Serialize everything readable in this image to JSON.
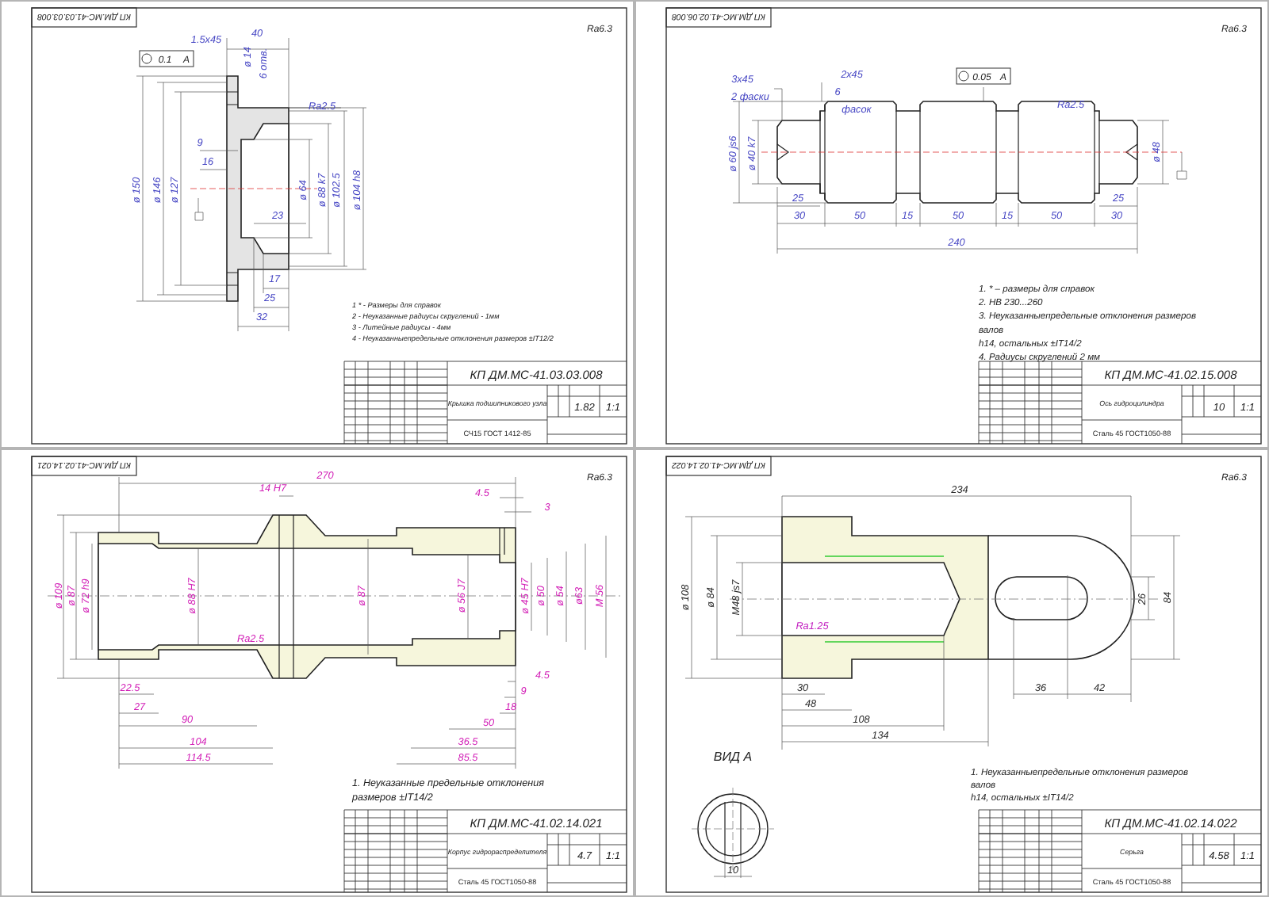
{
  "sheets": [
    {
      "kind": "flange",
      "stamp": "КП ДМ.МС-41.03.03.008",
      "roughness": "Ra6.3",
      "geometric_tolerance": {
        "value": "0.1",
        "datum": "A"
      },
      "annotations": [
        {
          "kind": "dimension",
          "text": "1.5x45"
        },
        {
          "kind": "dimension",
          "text": "40"
        },
        {
          "kind": "dimension",
          "text": "ø 14"
        },
        {
          "kind": "dimension",
          "text": "6 отв."
        },
        {
          "kind": "roughness",
          "text": "Ra2.5"
        },
        {
          "kind": "dimension",
          "text": "ø 150"
        },
        {
          "kind": "dimension",
          "text": "ø 146"
        },
        {
          "kind": "dimension",
          "text": "ø 127"
        },
        {
          "kind": "dimension",
          "text": "9"
        },
        {
          "kind": "dimension",
          "text": "16"
        },
        {
          "kind": "dimension",
          "text": "23"
        },
        {
          "kind": "dimension",
          "text": "ø 64"
        },
        {
          "kind": "dimension",
          "text": "ø 88 k7"
        },
        {
          "kind": "dimension",
          "text": "ø 102.5"
        },
        {
          "kind": "dimension",
          "text": "ø 104 h8"
        },
        {
          "kind": "dimension",
          "text": "17"
        },
        {
          "kind": "dimension",
          "text": "25"
        },
        {
          "kind": "dimension",
          "text": "32"
        }
      ],
      "notes": [
        "1 * - Размеры для справок",
        "2 - Неуказанные радиусы скруглений - 1мм",
        "3 - Литейные радиусы - 4мм",
        "4 - Неуказанныепредельные отклонения размеров ±IT12/2"
      ],
      "title_block": {
        "designation": "КП ДМ.МС-41.03.03.008",
        "name": "Крышка подшипникового узла",
        "material": "СЧ15 ГОСТ 1412-85",
        "mass": "1.82",
        "scale": "1:1"
      }
    },
    {
      "kind": "shaft",
      "stamp": "КП ДМ.МС-41.02.06.008",
      "roughness": "Ra6.3",
      "geometric_tolerance": {
        "value": "0.05",
        "datum": "A"
      },
      "annotations": [
        {
          "kind": "dimension",
          "text": "3x45"
        },
        {
          "kind": "dimension",
          "text": "2 фаски"
        },
        {
          "kind": "dimension",
          "text": "2x45"
        },
        {
          "kind": "dimension",
          "text": "6"
        },
        {
          "kind": "dimension",
          "text": "фасок"
        },
        {
          "kind": "roughness",
          "text": "Ra2.5"
        },
        {
          "kind": "dimension",
          "text": "ø 60 js6"
        },
        {
          "kind": "dimension",
          "text": "ø 40 k7"
        },
        {
          "kind": "dimension",
          "text": "ø 48"
        },
        {
          "kind": "dimension",
          "text": "25"
        },
        {
          "kind": "dimension",
          "text": "30"
        },
        {
          "kind": "dimension",
          "text": "50"
        },
        {
          "kind": "dimension",
          "text": "15"
        },
        {
          "kind": "dimension",
          "text": "50"
        },
        {
          "kind": "dimension",
          "text": "15"
        },
        {
          "kind": "dimension",
          "text": "50"
        },
        {
          "kind": "dimension",
          "text": "30"
        },
        {
          "kind": "dimension",
          "text": "25"
        },
        {
          "kind": "dimension",
          "text": "240"
        }
      ],
      "notes": [
        "1. * – размеры для справок",
        "2. НВ 230...260",
        "3. Неуказанныепредельные отклонения размеров",
        "валов",
        "h14, остальных ±IT14/2",
        "4. Радиусы скруглений 2 мм"
      ],
      "title_block": {
        "designation": "КП ДМ.МС-41.02.15.008",
        "name": "Ось гидроцилиндра",
        "material": "Сталь 45 ГОСТ1050-88",
        "mass": "10",
        "scale": "1:1"
      }
    },
    {
      "kind": "housing",
      "stamp": "КП ДМ.МС-41.02.14.021",
      "roughness": "Ra6.3",
      "annotations": [
        {
          "kind": "dimension",
          "text": "270"
        },
        {
          "kind": "dimension",
          "text": "14 H7"
        },
        {
          "kind": "dimension",
          "text": "4.5"
        },
        {
          "kind": "dimension",
          "text": "3"
        },
        {
          "kind": "dimension",
          "text": "ø 109"
        },
        {
          "kind": "dimension",
          "text": "ø 87"
        },
        {
          "kind": "dimension",
          "text": "ø 72 h9"
        },
        {
          "kind": "dimension",
          "text": "ø 88 H7"
        },
        {
          "kind": "dimension",
          "text": "ø 87"
        },
        {
          "kind": "dimension",
          "text": "ø 56 J7"
        },
        {
          "kind": "dimension",
          "text": "ø 45 H7"
        },
        {
          "kind": "dimension",
          "text": "ø 50"
        },
        {
          "kind": "dimension",
          "text": "ø 54"
        },
        {
          "kind": "dimension",
          "text": "ø63"
        },
        {
          "kind": "dimension",
          "text": "M 56"
        },
        {
          "kind": "roughness",
          "text": "Ra2.5"
        },
        {
          "kind": "dimension",
          "text": "4.5"
        },
        {
          "kind": "dimension",
          "text": "9"
        },
        {
          "kind": "dimension",
          "text": "18"
        },
        {
          "kind": "dimension",
          "text": "50"
        },
        {
          "kind": "dimension",
          "text": "36.5"
        },
        {
          "kind": "dimension",
          "text": "85.5"
        },
        {
          "kind": "dimension",
          "text": "22.5"
        },
        {
          "kind": "dimension",
          "text": "27"
        },
        {
          "kind": "dimension",
          "text": "90"
        },
        {
          "kind": "dimension",
          "text": "104"
        },
        {
          "kind": "dimension",
          "text": "114.5"
        }
      ],
      "notes": [
        "1. Неуказанные предельные отклонения",
        "размеров ±IT14/2"
      ],
      "title_block": {
        "designation": "КП ДМ.МС-41.02.14.021",
        "name": "Корпус гидрораспределителя",
        "material": "Сталь 45 ГОСТ1050-88",
        "mass": "4.7",
        "scale": "1:1"
      }
    },
    {
      "kind": "rod_end",
      "stamp": "КП ДМ.МС-41.02.14.022",
      "roughness": "Ra6.3",
      "annotations": [
        {
          "kind": "dimension",
          "text": "234"
        },
        {
          "kind": "dimension",
          "text": "ø 108"
        },
        {
          "kind": "dimension",
          "text": "ø 84"
        },
        {
          "kind": "dimension",
          "text": "M48 js7"
        },
        {
          "kind": "roughness",
          "text": "Ra1.25"
        },
        {
          "kind": "dimension",
          "text": "26"
        },
        {
          "kind": "dimension",
          "text": "84"
        },
        {
          "kind": "dimension",
          "text": "30"
        },
        {
          "kind": "dimension",
          "text": "48"
        },
        {
          "kind": "dimension",
          "text": "108"
        },
        {
          "kind": "dimension",
          "text": "134"
        },
        {
          "kind": "dimension",
          "text": "36"
        },
        {
          "kind": "dimension",
          "text": "42"
        },
        {
          "kind": "view",
          "text": "ВИД  А"
        },
        {
          "kind": "dimension",
          "text": "10"
        }
      ],
      "notes": [
        "1. Неуказанныепредельные отклонения размеров",
        "валов",
        "h14, остальных ±IT14/2"
      ],
      "title_block": {
        "designation": "КП ДМ.МС-41.02.14.022",
        "name": "Серьга",
        "material": "Сталь 45 ГОСТ1050-88",
        "mass": "4.58",
        "scale": "1:1"
      }
    }
  ]
}
